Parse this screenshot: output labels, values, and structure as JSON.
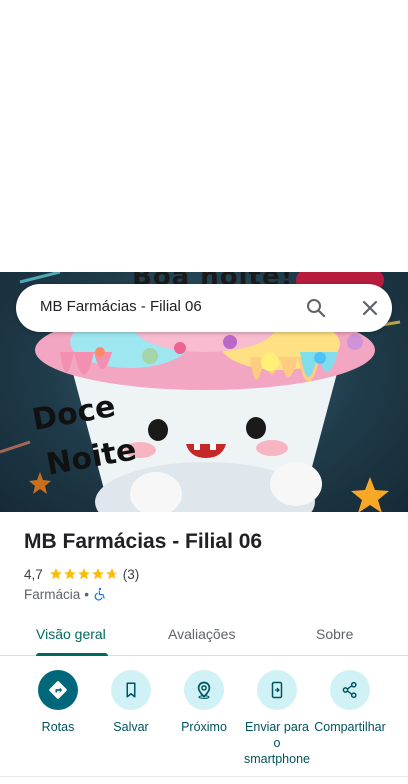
{
  "hero": {
    "top_text": "Boa noite!",
    "text_line1": "Doce",
    "text_line2": "Noite"
  },
  "search": {
    "query": "MB Farmácias - Filial 06",
    "search_icon": "search-icon",
    "close_icon": "close-icon"
  },
  "place": {
    "title": "MB Farmácias - Filial 06",
    "rating": "4,7",
    "stars": 4.7,
    "review_count": "(3)",
    "category": "Farmácia",
    "separator": "•",
    "accessibility_icon": "wheelchair-icon"
  },
  "tabs": [
    {
      "label": "Visão geral",
      "active": true
    },
    {
      "label": "Avaliações",
      "active": false
    },
    {
      "label": "Sobre",
      "active": false
    }
  ],
  "actions": [
    {
      "label": "Rotas",
      "icon": "directions-icon"
    },
    {
      "label": "Salvar",
      "icon": "bookmark-icon"
    },
    {
      "label": "Próximo",
      "icon": "nearby-icon"
    },
    {
      "label": "Enviar para o smartphone",
      "icon": "send-to-phone-icon"
    },
    {
      "label": "Compartilhar",
      "icon": "share-icon"
    }
  ],
  "colors": {
    "accent": "#00695c",
    "action_primary_bg": "#00687a",
    "action_bg": "#d0f1f5",
    "star": "#fbbc04"
  }
}
